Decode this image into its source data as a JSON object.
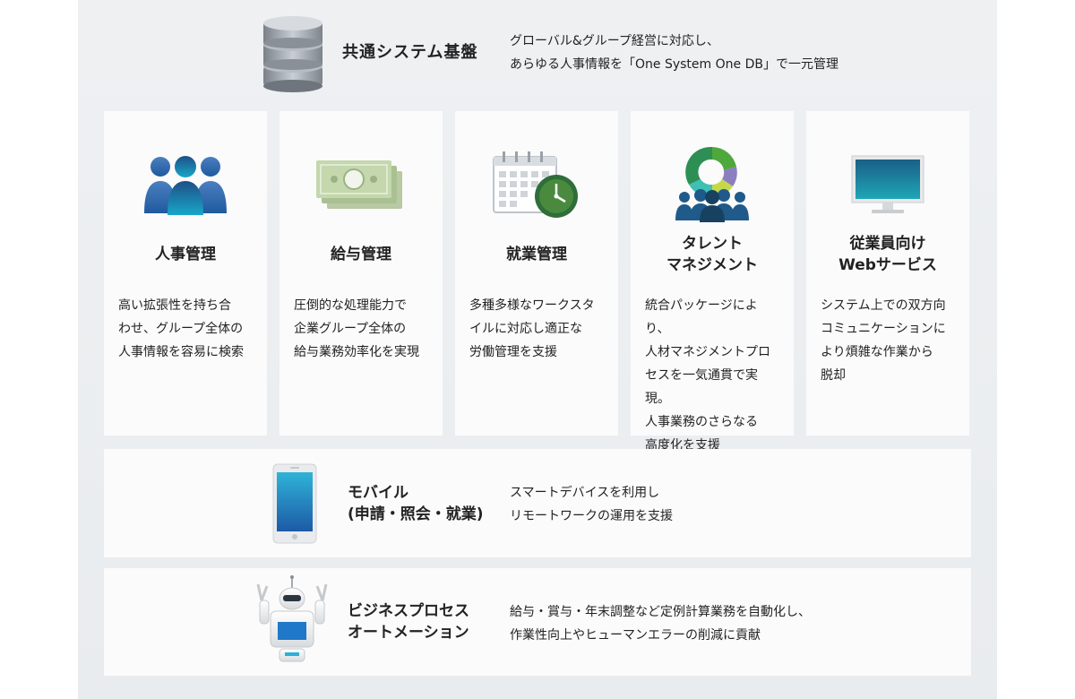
{
  "header": {
    "title": "共通システム基盤",
    "description": "グローバル&グループ経営に対応し、\nあらゆる人事情報を「One System One DB」で一元管理",
    "icon": "database-icon"
  },
  "cards": [
    {
      "title": "人事管理",
      "description": "高い拡張性を持ち合\nわせ、グループ全体の\n人事情報を容易に検索",
      "icon": "people-icon"
    },
    {
      "title": "給与管理",
      "description": "圧倒的な処理能力で\n企業グループ全体の\n給与業務効率化を実現",
      "icon": "banknote-icon"
    },
    {
      "title": "就業管理",
      "description": "多種多様なワークスタ\nイルに対応し適正な\n労働管理を支援",
      "icon": "calendar-clock-icon"
    },
    {
      "title": "タレント\nマネジメント",
      "description": "統合パッケージにより、\n人材マネジメントプロ\nセスを一気通貫で実現。\n人事業務のさらなる\n高度化を支援",
      "icon": "talent-ring-icon"
    },
    {
      "title": "従業員向け\nWebサービス",
      "description": "システム上での双方向\nコミュニケーションに\nより煩雑な作業から\n脱却",
      "icon": "monitor-icon"
    }
  ],
  "rows": [
    {
      "title": "モバイル\n(申請・照会・就業)",
      "description": "スマートデバイスを利用し\nリモートワークの運用を支援",
      "icon": "smartphone-icon"
    },
    {
      "title": "ビジネスプロセス\nオートメーション",
      "description": "給与・賞与・年末調整など定例計算業務を自動化し、\n作業性向上やヒューマンエラーの削減に貢献",
      "icon": "robot-icon"
    }
  ]
}
